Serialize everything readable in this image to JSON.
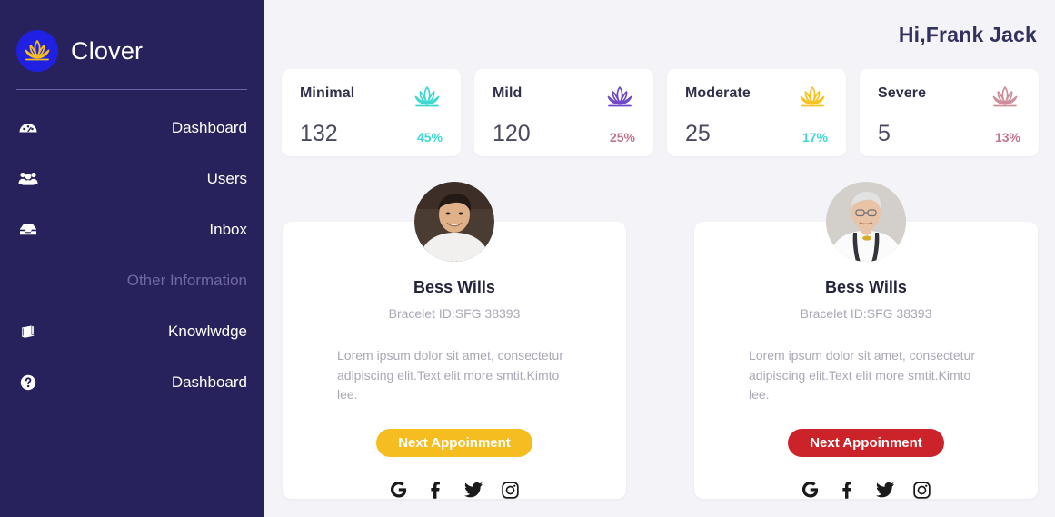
{
  "sidebar": {
    "brand": {
      "name": "Clover",
      "logo_icon": "lotus-logo-icon",
      "logo_bg": "#2020e2",
      "logo_fg": "#f5bd20"
    },
    "background": "#27215c",
    "nav": [
      {
        "label": "Dashboard",
        "icon": "speedometer-icon"
      },
      {
        "label": "Users",
        "icon": "users-icon"
      },
      {
        "label": "Inbox",
        "icon": "inbox-icon"
      }
    ],
    "section_title": "Other Information",
    "nav_other": [
      {
        "label": "Knowlwdge",
        "icon": "book-icon"
      },
      {
        "label": "Dashboard",
        "icon": "question-circle-icon"
      }
    ]
  },
  "header": {
    "greeting": "Hi,Frank Jack"
  },
  "stats": [
    {
      "label": "Minimal",
      "value": "132",
      "percent": "45%",
      "icon": "lotus-icon",
      "color": "#3fd8d0",
      "pct_color": "#3fd8d0"
    },
    {
      "label": "Mild",
      "value": "120",
      "percent": "25%",
      "icon": "lotus-icon",
      "color": "#7049c9",
      "pct_color": "#c2768c"
    },
    {
      "label": "Moderate",
      "value": "25",
      "percent": "17%",
      "icon": "lotus-icon",
      "color": "#f8c221",
      "pct_color": "#3fd8d0"
    },
    {
      "label": "Severe",
      "value": "5",
      "percent": "13%",
      "icon": "lotus-icon",
      "color": "#cc8f9b",
      "pct_color": "#c2768c"
    }
  ],
  "profiles": [
    {
      "avatar_icon": "avatar-young-man",
      "name": "Bess Wills",
      "bracelet": "Bracelet ID:SFG 38393",
      "description": "Lorem ipsum dolor sit amet, consectetur adipiscing elit.Text elit more smtit.Kimto lee.",
      "button_label": "Next Appoinment",
      "button_color": "#f5bd20",
      "socials": [
        "google-icon",
        "facebook-icon",
        "twitter-icon",
        "instagram-icon"
      ]
    },
    {
      "avatar_icon": "avatar-senior-doctor",
      "name": "Bess Wills",
      "bracelet": "Bracelet ID:SFG 38393",
      "description": "Lorem ipsum dolor sit amet, consectetur adipiscing elit.Text elit more smtit.Kimto lee.",
      "button_label": "Next Appoinment",
      "button_color": "#cc2229",
      "socials": [
        "google-icon",
        "facebook-icon",
        "twitter-icon",
        "instagram-icon"
      ]
    }
  ],
  "theme": {
    "page_bg": "#f4f3f8",
    "card_bg": "#ffffff",
    "text_dark": "#23233c",
    "text_muted": "#a9a8b6"
  }
}
